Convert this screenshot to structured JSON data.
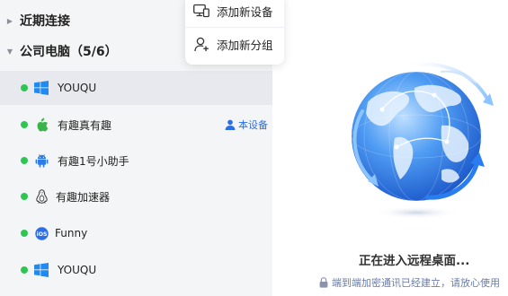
{
  "sidebar": {
    "groups": [
      {
        "label": "近期连接",
        "expanded": false
      },
      {
        "label": "公司电脑（5/6）",
        "expanded": true
      }
    ],
    "devices": [
      {
        "name": "YOUQU",
        "os": "windows",
        "online": true,
        "selected": true
      },
      {
        "name": "有趣真有趣",
        "os": "apple",
        "online": true,
        "selected": false
      },
      {
        "name": "有趣1号小助手",
        "os": "android",
        "online": true,
        "selected": false
      },
      {
        "name": "有趣加速器",
        "os": "linux",
        "online": true,
        "selected": false
      },
      {
        "name": "Funny",
        "os": "ios",
        "online": true,
        "selected": false
      },
      {
        "name": "YOUQU",
        "os": "windows",
        "online": true,
        "selected": false
      }
    ],
    "this_device_label": "本设备"
  },
  "menu": {
    "items": [
      {
        "label": "添加新设备",
        "icon": "devices-icon"
      },
      {
        "label": "添加新分组",
        "icon": "add-user-icon"
      }
    ]
  },
  "remote": {
    "status": "正在进入远程桌面...",
    "secure_note": "端到端加密通讯已经建立，请放心使用"
  },
  "colors": {
    "online": "#2dc653",
    "accent": "#2b6ee8",
    "windows": "#1f8bf0"
  }
}
